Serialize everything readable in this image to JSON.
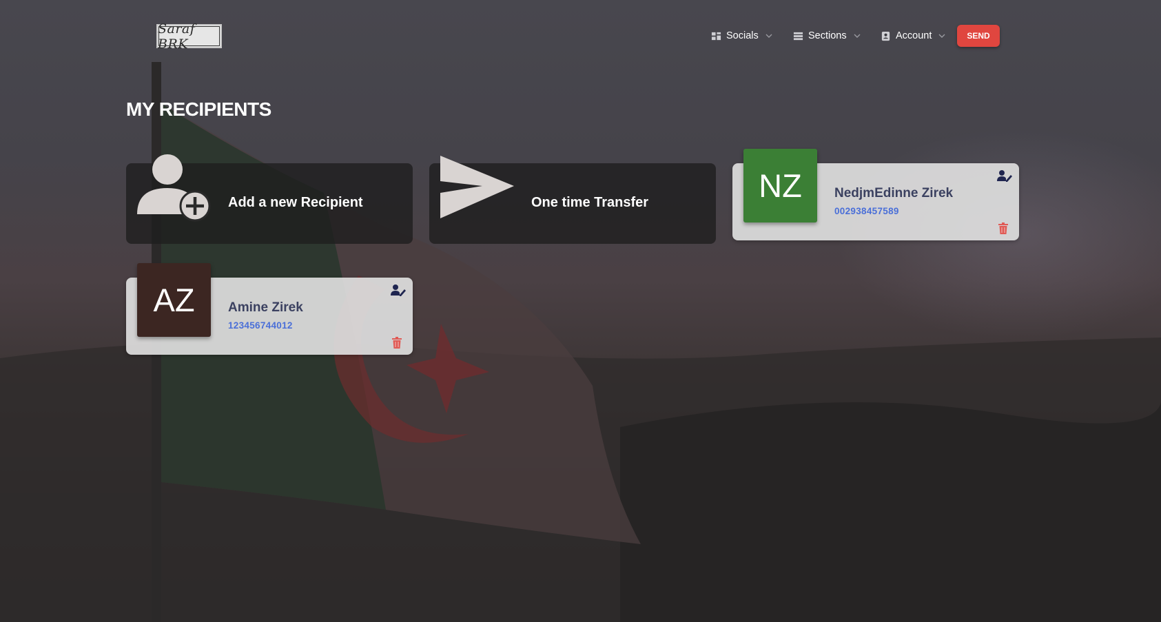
{
  "nav": {
    "logo_text": "Saraf BRK",
    "items": [
      {
        "label": "Socials",
        "icon": "dashboard-icon"
      },
      {
        "label": "Sections",
        "icon": "list-icon"
      },
      {
        "label": "Account",
        "icon": "account-box-icon"
      }
    ],
    "send_label": "SEND"
  },
  "page": {
    "title": "MY RECIPIENTS"
  },
  "actions": {
    "add_label": "Add a new Recipient",
    "add_icon": "add-user-icon",
    "transfer_label": "One time Transfer",
    "transfer_icon": "send-arrow-icon"
  },
  "recipients": [
    {
      "initials": "NZ",
      "name": "NedjmEdinne Zirek",
      "number": "002938457589",
      "avatar_color": "#3b7f35"
    },
    {
      "initials": "AZ",
      "name": "Amine Zirek",
      "number": "123456744012",
      "avatar_color": "#3c2622"
    }
  ],
  "colors": {
    "send_button": "#e0463f",
    "recipient_name": "#3b4160",
    "recipient_number": "#4a6fd8",
    "delete_icon": "#e05a55"
  }
}
